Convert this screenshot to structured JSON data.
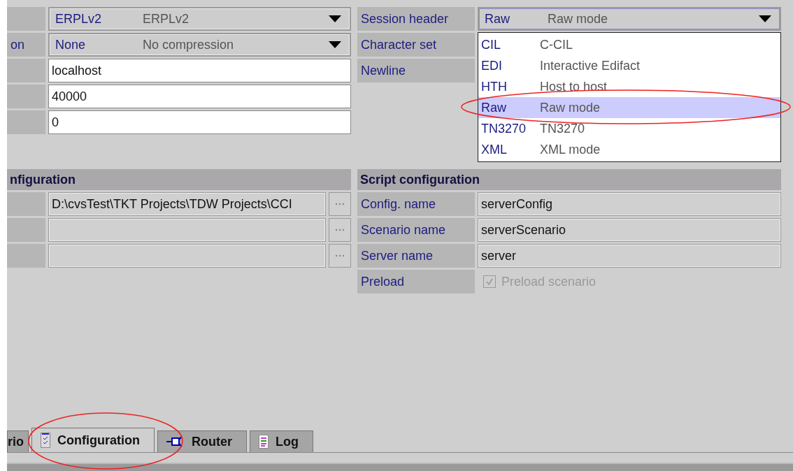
{
  "connection": {
    "rows": [
      {
        "kind": "select",
        "code": "ERPLv2",
        "description": "ERPLv2"
      },
      {
        "kind": "select",
        "label": "on",
        "code": "None",
        "description": "No compression"
      },
      {
        "kind": "text",
        "value": "localhost"
      },
      {
        "kind": "text",
        "value": "40000"
      },
      {
        "kind": "text",
        "value": "0"
      }
    ]
  },
  "session": {
    "rows": [
      {
        "kind": "select",
        "label": "Session header",
        "code": "Raw",
        "description": "Raw mode",
        "expanded": true
      },
      {
        "kind": "label",
        "label": "Character set"
      },
      {
        "kind": "label",
        "label": "Newline"
      }
    ],
    "options": [
      {
        "code": "CIL",
        "description": "C-CIL",
        "selected": false
      },
      {
        "code": "EDI",
        "description": "Interactive Edifact",
        "selected": false
      },
      {
        "code": "HTH",
        "description": "Host to host",
        "selected": false
      },
      {
        "code": "Raw",
        "description": "Raw mode",
        "selected": true
      },
      {
        "code": "TN3270",
        "description": "TN3270",
        "selected": false
      },
      {
        "code": "XML",
        "description": "XML mode",
        "selected": false
      }
    ]
  },
  "files": {
    "title": "nfiguration",
    "rows": [
      {
        "kind": "browse",
        "value": "D:\\cvsTest\\TKT Projects\\TDW Projects\\CCI"
      },
      {
        "kind": "browse"
      },
      {
        "kind": "browse"
      }
    ]
  },
  "script": {
    "title": "Script configuration",
    "rows": [
      {
        "kind": "text",
        "label": "Config. name",
        "value": "serverConfig"
      },
      {
        "kind": "text",
        "label": "Scenario name",
        "value": "serverScenario"
      },
      {
        "kind": "text",
        "label": "Server name",
        "value": "server"
      },
      {
        "kind": "checkbox",
        "label": "Preload",
        "text": "Preload scenario",
        "checked": true,
        "disabled": true
      }
    ]
  },
  "tabs": [
    {
      "label": "rio",
      "selected": false
    },
    {
      "label": "Configuration",
      "selected": true
    },
    {
      "label": "Router",
      "selected": false
    },
    {
      "label": "Log",
      "selected": false
    }
  ]
}
